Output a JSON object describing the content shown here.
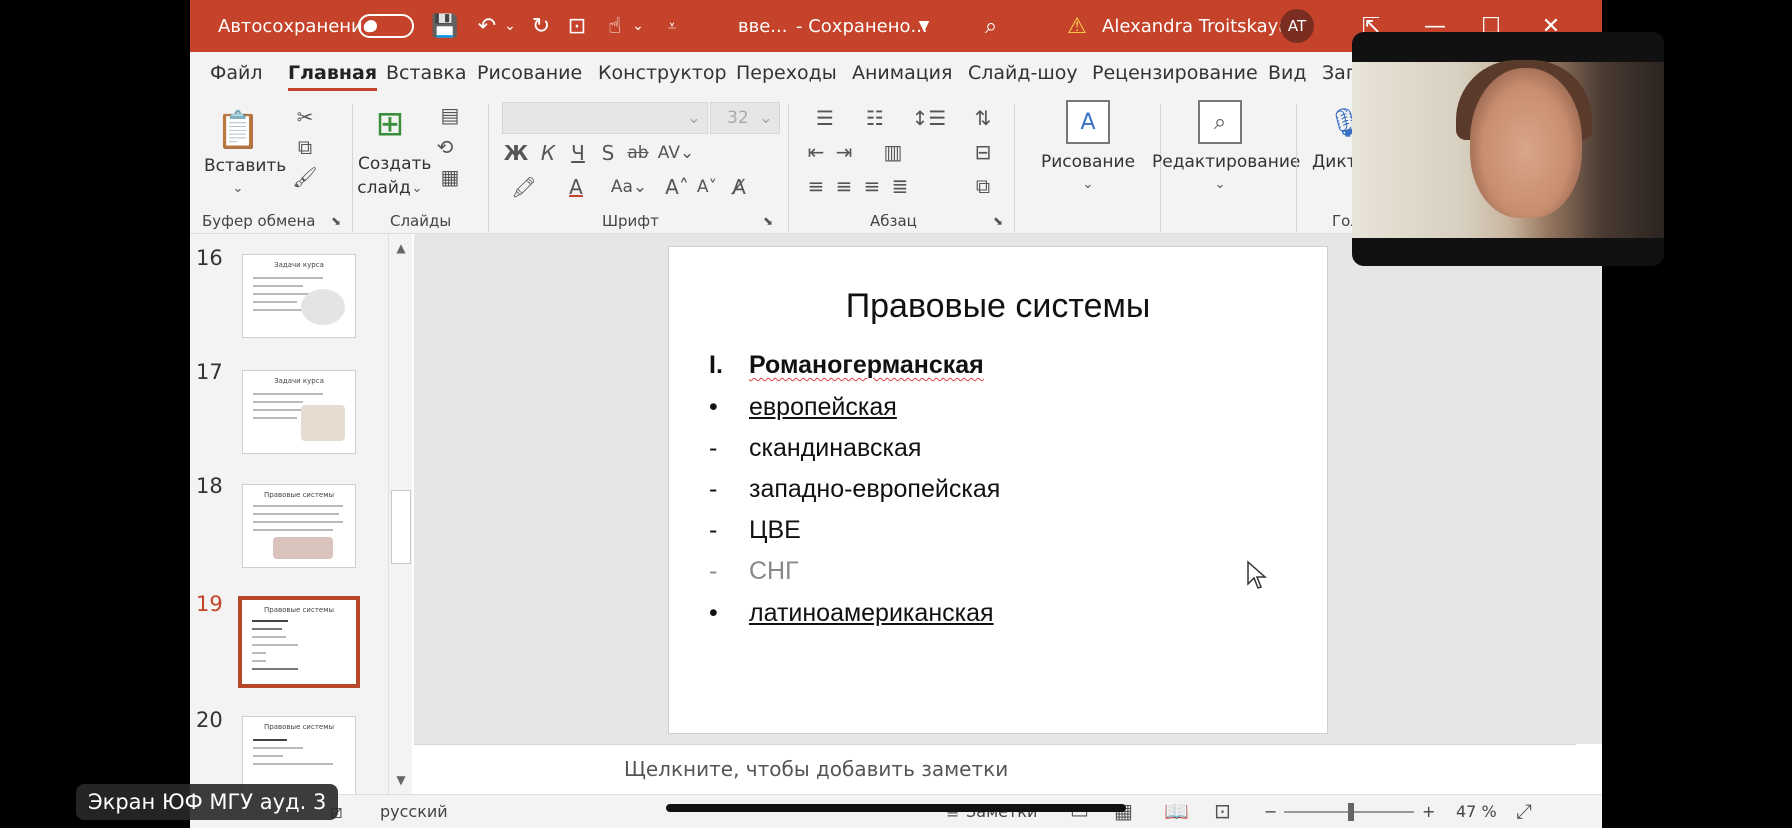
{
  "titlebar": {
    "autosave_label": "Автосохранение",
    "doc_title": "вве...",
    "status": "- Сохранено...",
    "user_name": "Alexandra Troitskaya",
    "user_initials": "AT"
  },
  "tabs": [
    "Файл",
    "Главная",
    "Вставка",
    "Рисование",
    "Конструктор",
    "Переходы",
    "Анимация",
    "Слайд-шоу",
    "Рецензирование",
    "Вид",
    "Зап"
  ],
  "ribbon": {
    "paste_label": "Вставить",
    "new_slide_line1": "Создать",
    "new_slide_line2": "слайд",
    "font_size": "32",
    "drawing_label": "Рисование",
    "editing_label": "Редактирование",
    "dictate_label": "Дикт",
    "groups": {
      "clipboard": "Буфер обмена",
      "slides": "Слайды",
      "font": "Шрифт",
      "paragraph": "Абзац",
      "voice": "Гол"
    }
  },
  "thumbnails": [
    {
      "number": "16",
      "title": "Задачи курса"
    },
    {
      "number": "17",
      "title": "Задачи курса"
    },
    {
      "number": "18",
      "title": "Правовые системы"
    },
    {
      "number": "19",
      "title": "Правовые системы"
    },
    {
      "number": "20",
      "title": "Правовые системы"
    }
  ],
  "slide": {
    "title": "Правовые системы",
    "items": [
      {
        "marker": "I.",
        "text": "Романогерманская"
      },
      {
        "marker": "•",
        "text": "европейская"
      },
      {
        "marker": "-",
        "text": "скандинавская"
      },
      {
        "marker": "-",
        "text": "западно-европейская"
      },
      {
        "marker": "-",
        "text": "ЦВЕ"
      },
      {
        "marker": "-",
        "text": "СНГ"
      },
      {
        "marker": "•",
        "text": "латиноамериканская"
      }
    ]
  },
  "notes_placeholder": "Щелкните, чтобы добавить заметки",
  "status": {
    "language": "русский",
    "notes": "Заметки",
    "zoom": "47 %"
  },
  "overlay": {
    "room_label": "Экран ЮФ МГУ ауд. 3"
  }
}
